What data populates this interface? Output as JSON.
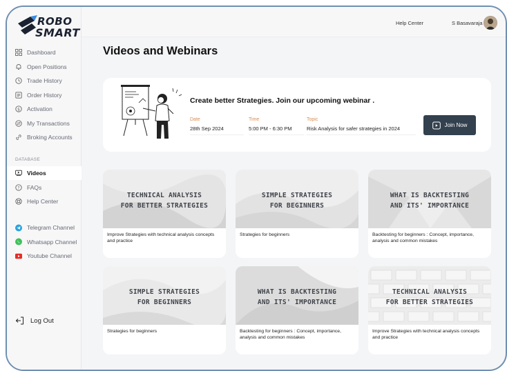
{
  "brand": {
    "line1": "ROBO",
    "line2": "SMART"
  },
  "header": {
    "help_center": "Help Center",
    "user_name": "S Basavaraja"
  },
  "sidebar": {
    "items": [
      {
        "label": "Dashboard",
        "icon": "grid-icon"
      },
      {
        "label": "Open Positions",
        "icon": "bell-icon"
      },
      {
        "label": "Trade History",
        "icon": "clock-icon"
      },
      {
        "label": "Order History",
        "icon": "list-icon"
      },
      {
        "label": "Activation",
        "icon": "dollar-icon"
      },
      {
        "label": "My Transactions",
        "icon": "exchange-icon"
      },
      {
        "label": "Broking Accounts",
        "icon": "link-icon"
      }
    ],
    "section_label": "DATABASE",
    "database_items": [
      {
        "label": "Videos",
        "icon": "video-icon",
        "active": true
      },
      {
        "label": "FAQs",
        "icon": "question-icon"
      },
      {
        "label": "Help Center",
        "icon": "lifebuoy-icon"
      }
    ],
    "channels": [
      {
        "label": "Telegram Channel",
        "icon": "telegram-icon",
        "color": "#2aa3df"
      },
      {
        "label": "Whatsapp Channel",
        "icon": "whatsapp-icon",
        "color": "#3ec159"
      },
      {
        "label": "Youtube Channel",
        "icon": "youtube-icon",
        "color": "#e52d27"
      }
    ],
    "logout": "Log Out"
  },
  "page": {
    "title": "Videos and Webinars"
  },
  "webinar": {
    "title": "Create better Strategies. Join our upcoming webinar .",
    "date_label": "Date",
    "date": "28th Sep 2024",
    "time_label": "Time",
    "time": "5:00 PM - 6:30 PM",
    "topic_label": "Topic",
    "topic": "Risk Analysis for safer strategies in 2024",
    "join_label": "Join Now"
  },
  "videos": [
    {
      "line1": "TECHNICAL ANALYSIS",
      "line2": "FOR BETTER STRATEGIES",
      "desc": "Improve Strategies with technical analysis concepts and practice"
    },
    {
      "line1": "SIMPLE STRATEGIES",
      "line2": "FOR BEGINNERS",
      "desc": "Strategies for beginners"
    },
    {
      "line1": "WHAT IS BACKTESTING",
      "line2": "AND ITS' IMPORTANCE",
      "desc": "Backtesting for beginners : Concept, importance, analysis and common mistakes"
    },
    {
      "line1": "SIMPLE STRATEGIES",
      "line2": "FOR BEGINNERS",
      "desc": "Strategies for beginners"
    },
    {
      "line1": "WHAT IS BACKTESTING",
      "line2": "AND ITS' IMPORTANCE",
      "desc": "Backtesting for beginners : Concept, importance, analysis and common mistakes"
    },
    {
      "line1": "TECHNICAL ANALYSIS",
      "line2": "FOR BETTER STRATEGIES",
      "desc": "Improve Strategies with technical analysis concepts and practice"
    }
  ],
  "colors": {
    "accent_orange": "#d88c55",
    "button_dark": "#33404e",
    "frame_border": "#6f8fb0"
  }
}
